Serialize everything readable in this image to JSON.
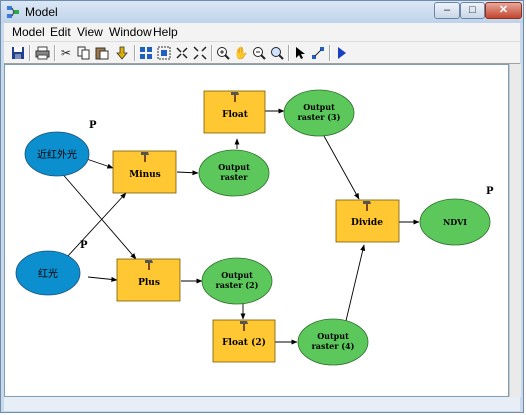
{
  "window": {
    "title": "Model"
  },
  "menu": [
    "Model",
    "Edit",
    "View",
    "Window",
    "Help"
  ],
  "diagram": {
    "inputs": [
      {
        "label": "近红外光",
        "param": "P"
      },
      {
        "label": "红光",
        "param": "P"
      }
    ],
    "tools": [
      {
        "label": "Minus"
      },
      {
        "label": "Plus"
      },
      {
        "label": "Float"
      },
      {
        "label": "Float (2)"
      },
      {
        "label": "Divide"
      }
    ],
    "outputs": [
      {
        "line1": "Output",
        "line2": "raster"
      },
      {
        "line1": "Output",
        "line2": "raster (2)"
      },
      {
        "line1": "Output",
        "line2": "raster (3)"
      },
      {
        "line1": "Output",
        "line2": "raster (4)"
      },
      {
        "line1": "NDVI",
        "line2": "",
        "param": "P"
      }
    ]
  },
  "colors": {
    "input": "#0c8fcf",
    "tool": "#ffc731",
    "output": "#5cc85c"
  }
}
